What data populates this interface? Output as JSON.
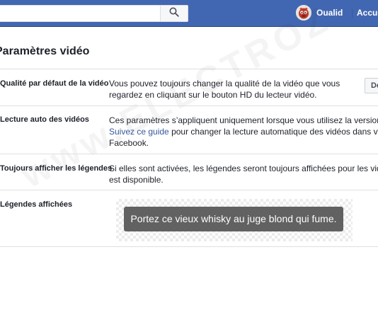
{
  "topbar": {
    "search_placeholder": "",
    "user_name": "Oualid",
    "home_label": "Accueil"
  },
  "page_title": "Paramètres vidéo",
  "settings": {
    "quality": {
      "label": "Qualité par défaut de la vidéo",
      "line1": "Vous pouvez toujours changer la qualité de la vidéo que vous",
      "line2": "regardez en cliquant sur le bouton HD du lecteur vidéo.",
      "button": "Défaut"
    },
    "autoplay": {
      "label": "Lecture auto des vidéos",
      "line1": "Ces paramètres s’appliquent uniquement lorsque vous utilisez la version",
      "line2_link": "Suivez ce guide",
      "line2_rest": " pour changer la lecture automatique des vidéos dans votre",
      "line3": "Facebook."
    },
    "captions_always": {
      "label": "Toujours afficher les légendes",
      "line1": "Si elles sont activées, les légendes seront toujours affichées pour les vidéos",
      "line2": "est disponible."
    },
    "captions_display": {
      "label": "Légendes affichées",
      "preview_text": "Portez ce vieux whisky au juge blond qui fume."
    }
  },
  "watermark": "www.ELECTROZ",
  "colors": {
    "topbar": "#4267b2",
    "link": "#365899",
    "divider": "#dddfe2"
  }
}
